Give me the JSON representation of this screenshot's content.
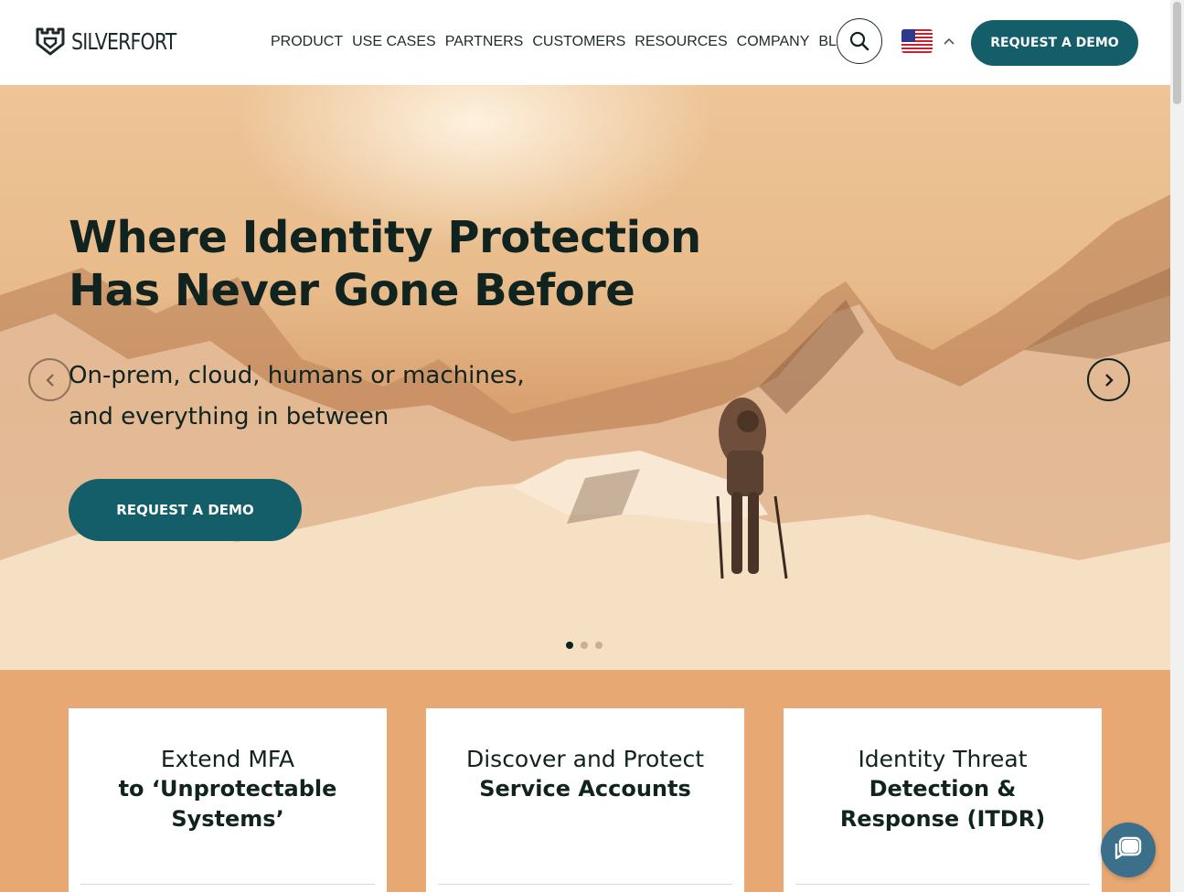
{
  "brand": {
    "name": "SILVERFORT",
    "logo_icon": "shield-icon"
  },
  "nav": {
    "items": [
      "PRODUCT",
      "USE CASES",
      "PARTNERS",
      "CUSTOMERS",
      "RESOURCES",
      "COMPANY",
      "BLOG"
    ],
    "search_icon": "search-icon",
    "language_flag": "us-flag-icon",
    "language_chevron": "chevron-up-icon",
    "demo_label": "REQUEST A DEMO"
  },
  "hero": {
    "headline_line1": "Where Identity Protection",
    "headline_line2": "Has Never Gone Before",
    "sub_line1": "On-prem, cloud, humans or machines,",
    "sub_line2": "and everything in between",
    "cta_label": "REQUEST A DEMO",
    "prev_icon": "chevron-left-icon",
    "next_icon": "chevron-right-icon",
    "slides": 3,
    "active_slide": 1
  },
  "cards": [
    {
      "title": "Extend MFA",
      "subtitle": "to ‘Unprotectable Systems’"
    },
    {
      "title": "Discover and Protect",
      "subtitle": "Service Accounts"
    },
    {
      "title": "Identity Threat",
      "subtitle": "Detection & Response (ITDR)"
    }
  ],
  "chat": {
    "icon": "chat-icon"
  },
  "colors": {
    "primary": "#135e68",
    "text": "#10231f",
    "section_bg": "#e8a873"
  }
}
